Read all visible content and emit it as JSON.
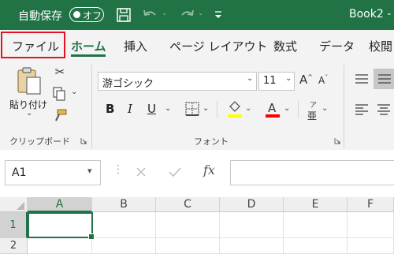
{
  "titlebar": {
    "autosave_label": "自動保存",
    "autosave_toggle": "オフ",
    "doc_title": "Book2 -"
  },
  "tabs": [
    {
      "label": "ファイル"
    },
    {
      "label": "ホーム"
    },
    {
      "label": "挿入"
    },
    {
      "label": "ページ レイアウト"
    },
    {
      "label": "数式"
    },
    {
      "label": "データ"
    },
    {
      "label": "校閲"
    }
  ],
  "ribbon": {
    "clipboard": {
      "paste_label": "貼り付け",
      "group_label": "クリップボード"
    },
    "font": {
      "font_name": "游ゴシック",
      "font_size": "11",
      "group_label": "フォント",
      "bold": "B",
      "italic": "I",
      "underline": "U",
      "phonetic_top": "ア",
      "phonetic_bottom": "亜"
    }
  },
  "formula_bar": {
    "name_box": "A1",
    "fx": "fx"
  },
  "grid": {
    "columns": [
      "A",
      "B",
      "C",
      "D",
      "E",
      "F"
    ],
    "rows": [
      "1",
      "2"
    ]
  },
  "colors": {
    "brand": "#217346",
    "highlight": "#e81123",
    "fill_swatch": "#ffff00",
    "font_swatch": "#ff0000"
  }
}
